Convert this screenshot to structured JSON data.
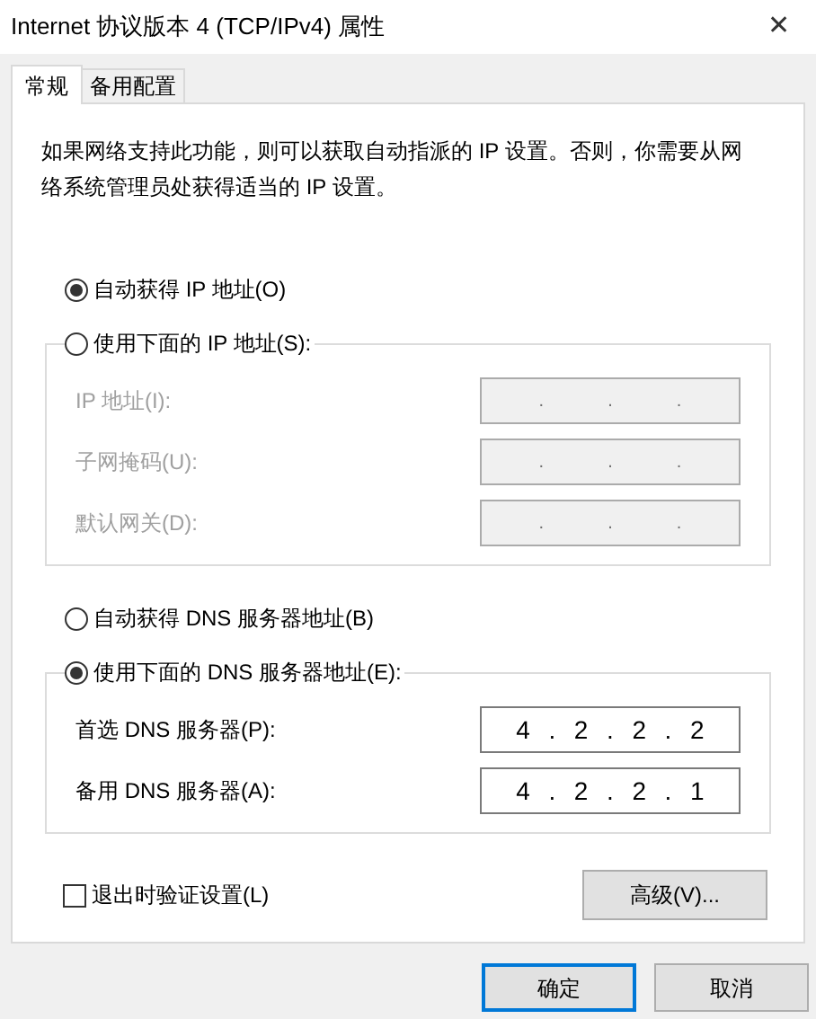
{
  "window": {
    "title": "Internet 协议版本 4 (TCP/IPv4) 属性",
    "close": "✕"
  },
  "tabs": [
    {
      "label": "常规",
      "selected": true
    },
    {
      "label": "备用配置",
      "selected": false
    }
  ],
  "description": "如果网络支持此功能，则可以获取自动指派的 IP 设置。否则，你需要从网络系统管理员处获得适当的 IP 设置。",
  "ip_mode": {
    "options": [
      {
        "label": "自动获得 IP 地址(O)",
        "selected": true
      },
      {
        "label": "使用下面的 IP 地址(S):",
        "selected": false
      }
    ],
    "disabled": true,
    "fields": [
      {
        "label": "IP 地址(I):",
        "segments": [
          ".",
          ".",
          "."
        ]
      },
      {
        "label": "子网掩码(U):",
        "segments": [
          ".",
          ".",
          "."
        ]
      },
      {
        "label": "默认网关(D):",
        "segments": [
          ".",
          ".",
          "."
        ]
      }
    ]
  },
  "dns_mode": {
    "options": [
      {
        "label": "自动获得 DNS 服务器地址(B)",
        "selected": false
      },
      {
        "label": "使用下面的 DNS 服务器地址(E):",
        "selected": true
      }
    ],
    "disabled": false,
    "fields": [
      {
        "label": "首选 DNS 服务器(P):",
        "segments": [
          "4",
          ".",
          "2",
          ".",
          "2",
          ".",
          "2"
        ]
      },
      {
        "label": "备用 DNS 服务器(A):",
        "segments": [
          "4",
          ".",
          "2",
          ".",
          "2",
          ".",
          "1"
        ]
      }
    ]
  },
  "validate": {
    "label": "退出时验证设置(L)",
    "checked": false
  },
  "advanced_button": "高级(V)...",
  "buttons": [
    {
      "label": "确定",
      "default": true
    },
    {
      "label": "取消",
      "default": false
    }
  ]
}
